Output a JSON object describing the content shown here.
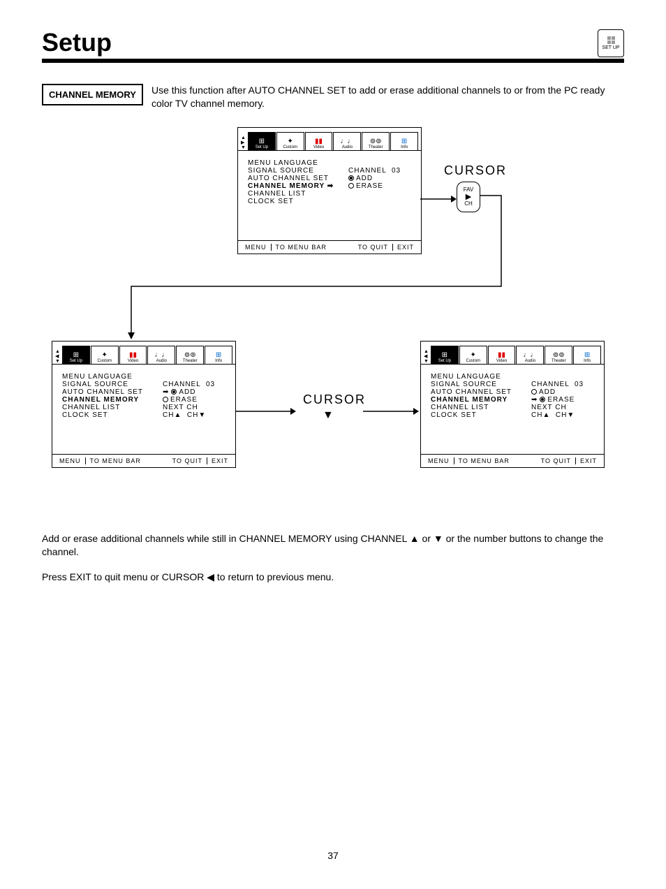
{
  "header": {
    "title": "Setup",
    "corner_label": "SET UP"
  },
  "section": {
    "label": "CHANNEL MEMORY",
    "intro": "Use this function after AUTO CHANNEL SET to add or erase additional channels to or from the PC ready color TV channel memory."
  },
  "tabs": [
    "Set Up",
    "Custom",
    "Video",
    "Audio",
    "Theater",
    "Info"
  ],
  "panel_common": {
    "menu_items": [
      "MENU LANGUAGE",
      "SIGNAL SOURCE",
      "AUTO CHANNEL SET",
      "CHANNEL MEMORY",
      "CHANNEL LIST",
      "CLOCK SET"
    ],
    "footer_menu": "MENU",
    "footer_bar": "TO MENU BAR",
    "footer_quit": "TO QUIT",
    "footer_exit": "EXIT"
  },
  "panel1": {
    "right": {
      "channel": "CHANNEL  03",
      "add": "ADD",
      "erase": "ERASE"
    }
  },
  "panel2": {
    "right": {
      "channel": "CHANNEL  03",
      "add": "ADD",
      "erase": "ERASE",
      "next": "NEXT CH",
      "ch": "CH▲  CH▼"
    }
  },
  "panel3": {
    "right": {
      "channel": "CHANNEL  03",
      "add": "ADD",
      "erase": "ERASE",
      "next": "NEXT CH",
      "ch": "CH▲  CH▼"
    }
  },
  "labels": {
    "cursor": "CURSOR",
    "remote": {
      "fav": "FAV",
      "play": "▶",
      "ch": "CH"
    },
    "down_triangle": "▼"
  },
  "instructions": {
    "p1": "Add or erase additional channels while still in CHANNEL MEMORY using CHANNEL ▲ or ▼ or the number buttons to change the channel.",
    "p2": "Press EXIT to quit menu or CURSOR ◀ to return to previous menu."
  },
  "page": "37"
}
